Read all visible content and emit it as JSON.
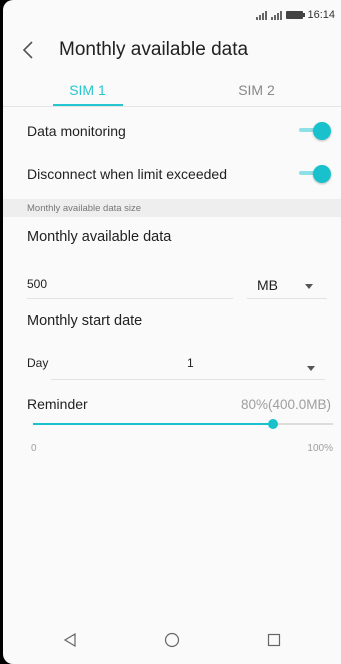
{
  "status_bar": {
    "time": "16:14"
  },
  "header": {
    "title": "Monthly available data"
  },
  "tabs": [
    {
      "label": "SIM 1",
      "active": true
    },
    {
      "label": "SIM 2",
      "active": false
    }
  ],
  "settings": {
    "data_monitoring": {
      "label": "Data monitoring",
      "enabled": true
    },
    "disconnect": {
      "label": "Disconnect when limit exceeded",
      "enabled": true
    }
  },
  "section_header": "Monthly available data size",
  "data_limit": {
    "title": "Monthly available data",
    "value": "500",
    "unit": "MB"
  },
  "start_date": {
    "title": "Monthly start date",
    "day_label": "Day",
    "day_value": "1"
  },
  "reminder": {
    "label": "Reminder",
    "value_text": "80%(400.0MB)",
    "percent": 80,
    "min_label": "0",
    "max_label": "100%"
  },
  "colors": {
    "accent": "#19c1cc",
    "tab_active": "#26c6d0"
  },
  "icons": {
    "back": "chevron-left-icon",
    "nav_back": "triangle-back-icon",
    "nav_home": "circle-home-icon",
    "nav_recents": "square-recents-icon"
  }
}
